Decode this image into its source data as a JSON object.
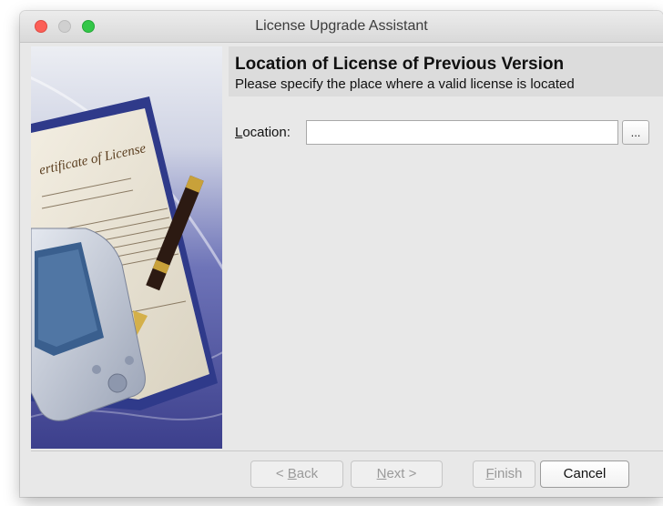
{
  "window": {
    "title": "License Upgrade Assistant"
  },
  "header": {
    "title": "Location of License of Previous Version",
    "subtitle": "Please specify the place where a valid license is located"
  },
  "form": {
    "location_label_prefix": "L",
    "location_label_rest": "ocation:",
    "location_value": "",
    "browse_label": "..."
  },
  "footer": {
    "back_prefix": "< ",
    "back_mnemonic": "B",
    "back_rest": "ack",
    "next_mnemonic": "N",
    "next_rest": "ext >",
    "finish_mnemonic": "F",
    "finish_rest": "inish",
    "cancel_label": "Cancel"
  },
  "colors": {
    "close": "#fc5f57",
    "minimize_inactive": "#d0d0d0",
    "maximize": "#33c748",
    "window_bg": "#e8e8e8",
    "header_bg": "#dcdcdc",
    "disabled_text": "#9a9a9a"
  },
  "icons": [
    "close-dot-icon",
    "minimize-dot-icon",
    "maximize-dot-icon"
  ]
}
